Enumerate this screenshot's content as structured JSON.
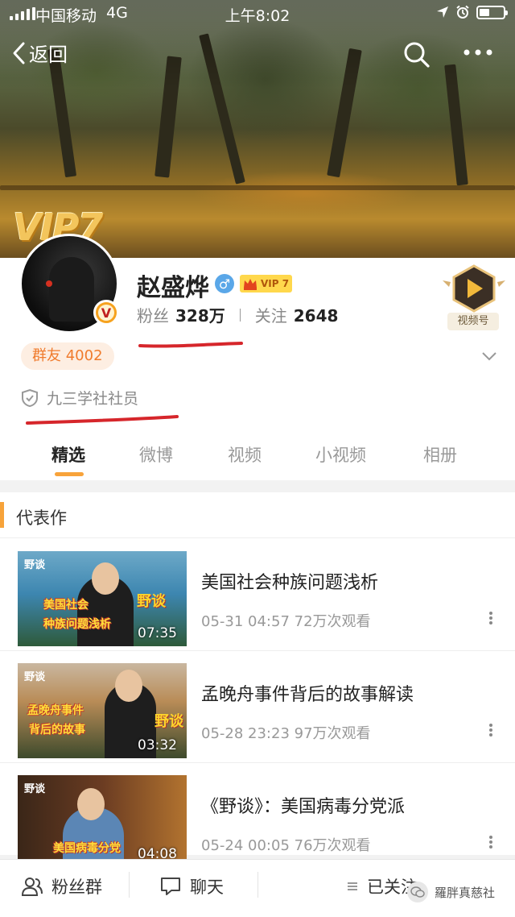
{
  "status_bar": {
    "carrier": "中国移动",
    "network": "4G",
    "time": "上午8:02"
  },
  "nav": {
    "back_label": "返回"
  },
  "profile": {
    "vip_banner": "VIP7",
    "name": "赵盛烨",
    "vip_tag": "VIP 7",
    "fans_label": "粉丝",
    "fans_count": "328万",
    "following_label": "关注",
    "following_count": "2648",
    "video_badge_label": "视频号",
    "group_label": "群友 4002",
    "organization": "九三学社社员",
    "v_badge": "V"
  },
  "tabs": [
    {
      "label": "精选",
      "active": true
    },
    {
      "label": "微博",
      "active": false
    },
    {
      "label": "视频",
      "active": false
    },
    {
      "label": "小视频",
      "active": false
    },
    {
      "label": "相册",
      "active": false
    }
  ],
  "section": {
    "title": "代表作"
  },
  "videos": [
    {
      "title": "美国社会种族问题浅析",
      "meta": "05-31 04:57 72万次观看",
      "duration": "07:35",
      "thumb_logo": "野谈",
      "thumb_caption_1": "美国社会",
      "thumb_caption_2": "种族问题浅析",
      "thumb_tag": "野谈"
    },
    {
      "title": "孟晚舟事件背后的故事解读",
      "meta": "05-28 23:23 97万次观看",
      "duration": "03:32",
      "thumb_logo": "野谈",
      "thumb_caption_1": "孟晚舟事件",
      "thumb_caption_2": "背后的故事",
      "thumb_tag": "野谈"
    },
    {
      "title": "《野谈》：美国病毒分党派",
      "meta": "05-24 00:05 76万次观看",
      "duration": "04:08",
      "thumb_logo": "野谈",
      "thumb_caption_1": "美国病毒分党",
      "thumb_caption_2": "",
      "thumb_tag": ""
    }
  ],
  "bottom_bar": {
    "fans_group_label": "粉丝群",
    "chat_label": "聊天",
    "followed_label": "已关注",
    "watermark": "羅胖真慈社"
  },
  "colors": {
    "accent_orange": "#f7a33a",
    "underline_red": "#d6262b",
    "vip_gold": "#ffd84c",
    "gender_blue": "#5aa7e8"
  }
}
